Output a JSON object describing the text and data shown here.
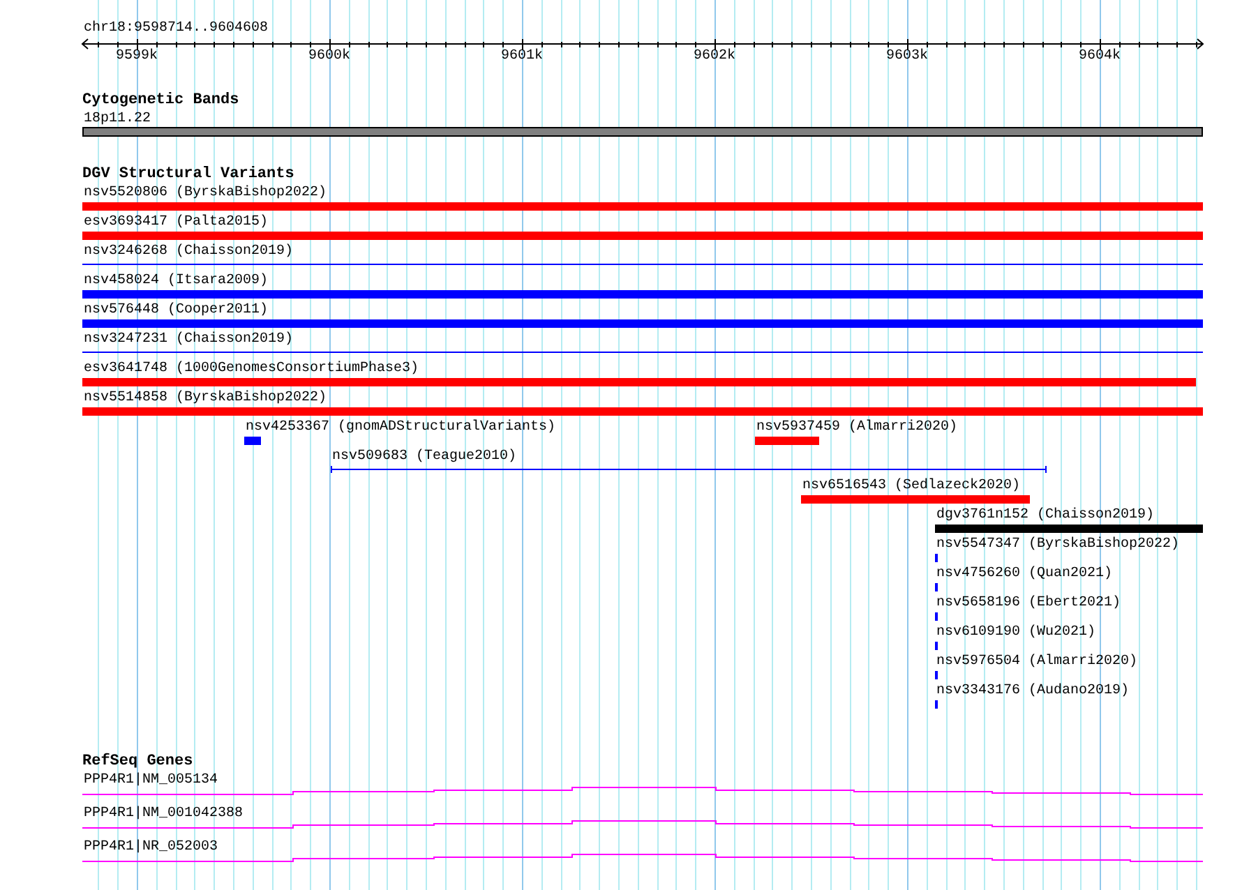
{
  "ruler": {
    "location": "chr18:9598714..9604608",
    "ticks": [
      "9599k",
      "9600k",
      "9601k",
      "9602k",
      "9603k",
      "9604k"
    ]
  },
  "tracks": [
    {
      "kind": "cytoband",
      "title": "Cytogenetic Bands",
      "rows": [
        {
          "features": [
            {
              "label": "18p11.22",
              "kind": "band",
              "color": "#808080"
            }
          ]
        }
      ]
    },
    {
      "kind": "variants",
      "title": "DGV Structural Variants",
      "rows": [
        {
          "features": [
            {
              "label": "nsv5520806 (ByrskaBishop2022)",
              "kind": "bar",
              "color": "#ff0000"
            }
          ]
        },
        {
          "features": [
            {
              "label": "esv3693417 (Palta2015)",
              "kind": "bar",
              "color": "#ff0000"
            }
          ]
        },
        {
          "features": [
            {
              "label": "nsv3246268 (Chaisson2019)",
              "kind": "line",
              "color": "#0000ff"
            }
          ]
        },
        {
          "features": [
            {
              "label": "nsv458024 (Itsara2009)",
              "kind": "bar",
              "color": "#0000ff"
            }
          ]
        },
        {
          "features": [
            {
              "label": "nsv576448 (Cooper2011)",
              "kind": "bar",
              "color": "#0000ff"
            }
          ]
        },
        {
          "features": [
            {
              "label": "nsv3247231 (Chaisson2019)",
              "kind": "line",
              "color": "#0000ff"
            }
          ]
        },
        {
          "features": [
            {
              "label": "esv3641748 (1000GenomesConsortiumPhase3)",
              "kind": "bar",
              "color": "#ff0000"
            }
          ]
        },
        {
          "features": [
            {
              "label": "nsv5514858 (ByrskaBishop2022)",
              "kind": "bar",
              "color": "#ff0000"
            }
          ]
        },
        {
          "features": [
            {
              "label": "nsv4253367 (gnomADStructuralVariants)",
              "kind": "bar",
              "color": "#0000ff"
            },
            {
              "label": "nsv5937459 (Almarri2020)",
              "kind": "bar",
              "color": "#ff0000"
            }
          ]
        },
        {
          "features": [
            {
              "label": "nsv509683 (Teague2010)",
              "kind": "bracket",
              "color": "#0000ff"
            }
          ]
        },
        {
          "features": [
            {
              "label": "nsv6516543 (Sedlazeck2020)",
              "kind": "bar",
              "color": "#ff0000"
            }
          ]
        },
        {
          "features": [
            {
              "label": "dgv3761n152 (Chaisson2019)",
              "kind": "bar",
              "color": "#000000"
            }
          ]
        },
        {
          "features": [
            {
              "label": "nsv5547347 (ByrskaBishop2022)",
              "kind": "bar",
              "color": "#0000ff"
            }
          ]
        },
        {
          "features": [
            {
              "label": "nsv4756260 (Quan2021)",
              "kind": "bar",
              "color": "#0000ff"
            }
          ]
        },
        {
          "features": [
            {
              "label": "nsv5658196 (Ebert2021)",
              "kind": "bar",
              "color": "#0000ff"
            }
          ]
        },
        {
          "features": [
            {
              "label": "nsv6109190 (Wu2021)",
              "kind": "bar",
              "color": "#0000ff"
            }
          ]
        },
        {
          "features": [
            {
              "label": "nsv5976504 (Almarri2020)",
              "kind": "bar",
              "color": "#0000ff"
            }
          ]
        },
        {
          "features": [
            {
              "label": "nsv3343176 (Audano2019)",
              "kind": "bar",
              "color": "#0000ff"
            }
          ]
        }
      ]
    },
    {
      "kind": "genes",
      "title": "RefSeq Genes",
      "rows": [
        {
          "features": [
            {
              "label": "PPP4R1|NM_005134",
              "kind": "gene",
              "color": "#ff00ff"
            }
          ]
        },
        {
          "features": [
            {
              "label": "PPP4R1|NM_001042388",
              "kind": "gene",
              "color": "#ff00ff"
            }
          ]
        },
        {
          "features": [
            {
              "label": "PPP4R1|NR_052003",
              "kind": "gene",
              "color": "#ff00ff"
            }
          ]
        }
      ]
    }
  ]
}
